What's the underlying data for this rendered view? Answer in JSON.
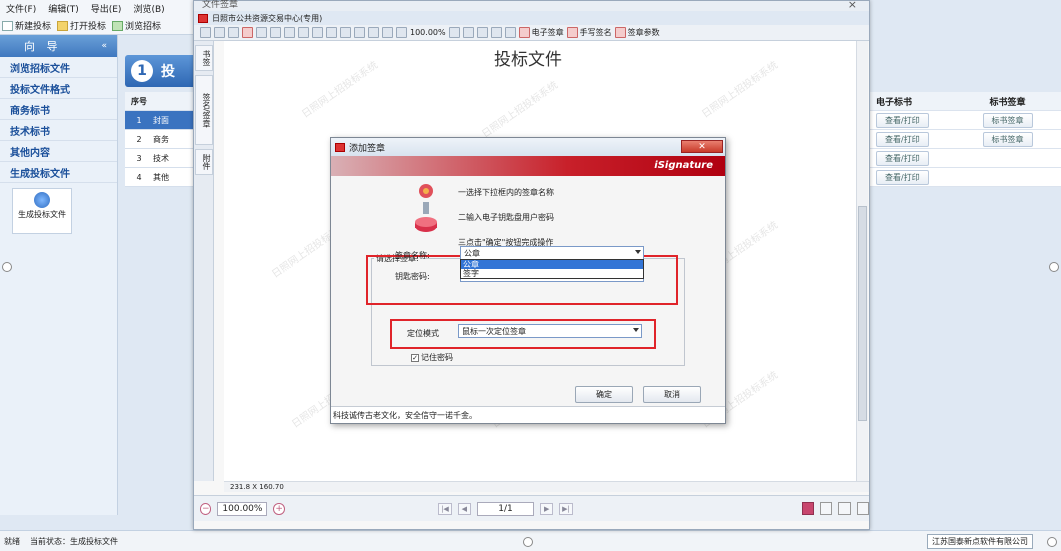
{
  "menu": [
    "文件(F)",
    "编辑(T)",
    "导出(E)",
    "浏览(B)"
  ],
  "toolbar": {
    "new": "新建投标",
    "open": "打开投标",
    "browse": "浏览招标"
  },
  "sidebar": {
    "header": "向 导",
    "arrow": "«",
    "items": [
      "浏览招标文件",
      "投标文件格式",
      "商务标书",
      "技术标书",
      "其他内容",
      "生成投标文件"
    ],
    "tile_label": "生成投标文件"
  },
  "step": {
    "num": "1",
    "title": "投"
  },
  "bg_table": {
    "header": {
      "no": "序号"
    },
    "rows": [
      {
        "no": "1",
        "name": "封面"
      },
      {
        "no": "2",
        "name": "商务"
      },
      {
        "no": "3",
        "name": "技术"
      },
      {
        "no": "4",
        "name": "其他"
      }
    ]
  },
  "right_table": {
    "headers": [
      "电子标书",
      "标书签章"
    ],
    "rows": [
      {
        "view": "查看/打印",
        "sign": "标书签章"
      },
      {
        "view": "查看/打印",
        "sign": "标书签章"
      },
      {
        "view": "查看/打印",
        "sign": ""
      },
      {
        "view": "查看/打印",
        "sign": ""
      }
    ]
  },
  "statusbar": {
    "ready": "就绪",
    "state": "当前状态：生成投标文件",
    "company": "江苏国泰新点软件有限公司"
  },
  "viewer": {
    "title_partial": "文件签章",
    "subtitle": "日照市公共资源交易中心(专用)",
    "zoom_toolbar": "100.00%",
    "tool_labels": [
      "电子签章",
      "手写签名",
      "签章参数"
    ],
    "side_tabs": [
      "书签",
      "签名/签章",
      "附件"
    ],
    "doc_title": "投标文件",
    "dimensions": "231.8 X 160.70",
    "zoom": "100.00%",
    "page": "1/1",
    "watermark": "日照网上招投标系统"
  },
  "dialog": {
    "title": "添加签章",
    "close": "✕",
    "brand": "iSignature",
    "steps": [
      "一选择下拉框内的签章名称",
      "二输入电子钥匙盘用户密码",
      "三点击\"确定\"按钮完成操作"
    ],
    "group_label": "请选择签章:",
    "seal_label": "签章名称:",
    "seal_value": "公章",
    "seal_options": [
      "公章",
      "签字"
    ],
    "password_label": "钥匙密码:",
    "mode_label": "定位模式",
    "mode_value": "鼠标一次定位签章",
    "remember": "记住密码",
    "ok": "确定",
    "cancel": "取消",
    "footer": "科技诚传古老文化，安全信守一诺千金。"
  },
  "colors": {
    "accent": "#3a73c0",
    "highlight_box": "#e0242a",
    "dialog_band": "#c8202a"
  }
}
